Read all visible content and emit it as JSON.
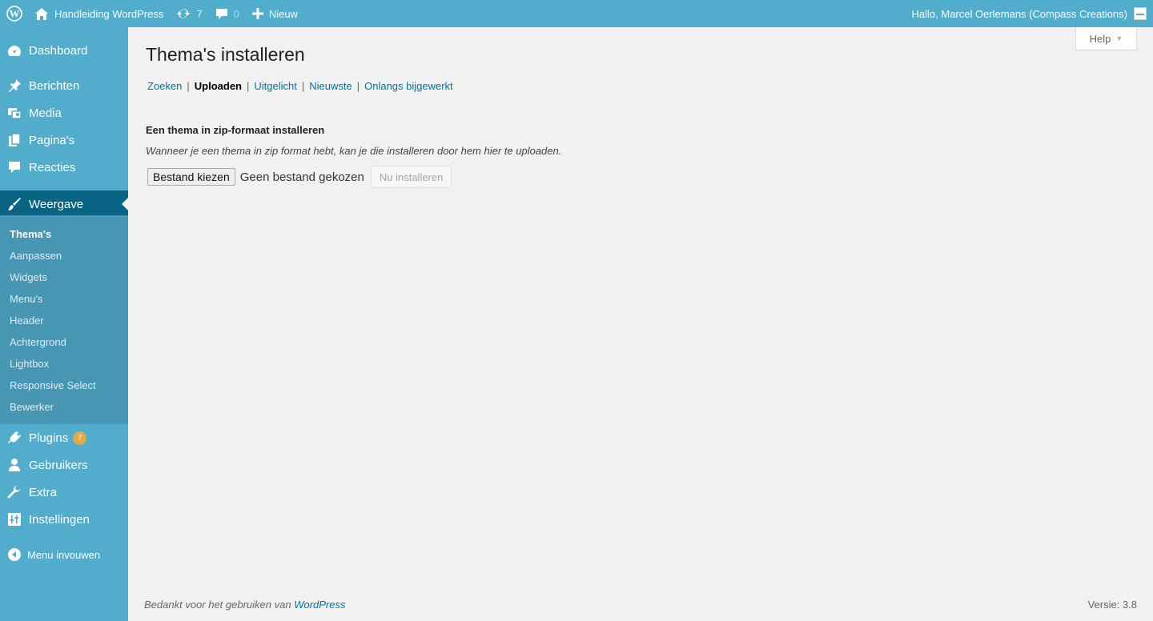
{
  "adminbar": {
    "site_name": "Handleiding WordPress",
    "updates_count": "7",
    "comments_count": "0",
    "new_label": "Nieuw",
    "greeting": "Hallo, Marcel Oerlemans (Compass Creations)"
  },
  "sidebar": {
    "items": [
      {
        "label": "Dashboard",
        "icon": "dashboard-icon"
      },
      {
        "label": "Berichten",
        "icon": "pin-icon"
      },
      {
        "label": "Media",
        "icon": "media-icon"
      },
      {
        "label": "Pagina's",
        "icon": "pages-icon"
      },
      {
        "label": "Reacties",
        "icon": "comment-icon"
      },
      {
        "label": "Weergave",
        "icon": "brush-icon",
        "current": true
      },
      {
        "label": "Plugins",
        "icon": "plugin-icon",
        "badge": "7"
      },
      {
        "label": "Gebruikers",
        "icon": "users-icon"
      },
      {
        "label": "Extra",
        "icon": "wrench-icon"
      },
      {
        "label": "Instellingen",
        "icon": "settings-icon"
      }
    ],
    "submenu": [
      "Thema's",
      "Aanpassen",
      "Widgets",
      "Menu's",
      "Header",
      "Achtergrond",
      "Lightbox",
      "Responsive Select",
      "Bewerker"
    ],
    "collapse_label": "Menu invouwen"
  },
  "help_label": "Help",
  "page": {
    "title": "Thema's installeren",
    "tabs": [
      "Zoeken",
      "Uploaden",
      "Uitgelicht",
      "Nieuwste",
      "Onlangs bijgewerkt"
    ],
    "section_title": "Een thema in zip-formaat installeren",
    "description": "Wanneer je een thema in zip format hebt, kan je die installeren door hem hier te uploaden.",
    "file_button": "Bestand kiezen",
    "file_status": "Geen bestand gekozen",
    "install_button": "Nu installeren"
  },
  "footer": {
    "thanks_prefix": "Bedankt voor het gebruiken van ",
    "thanks_link": "WordPress",
    "version": "Versie: 3.8"
  },
  "colors": {
    "adminbar": "#52accc",
    "sidebar": "#52accc",
    "submenu": "#4796b3",
    "current": "#096484",
    "badge": "#e1a948",
    "link": "#0074a2"
  }
}
